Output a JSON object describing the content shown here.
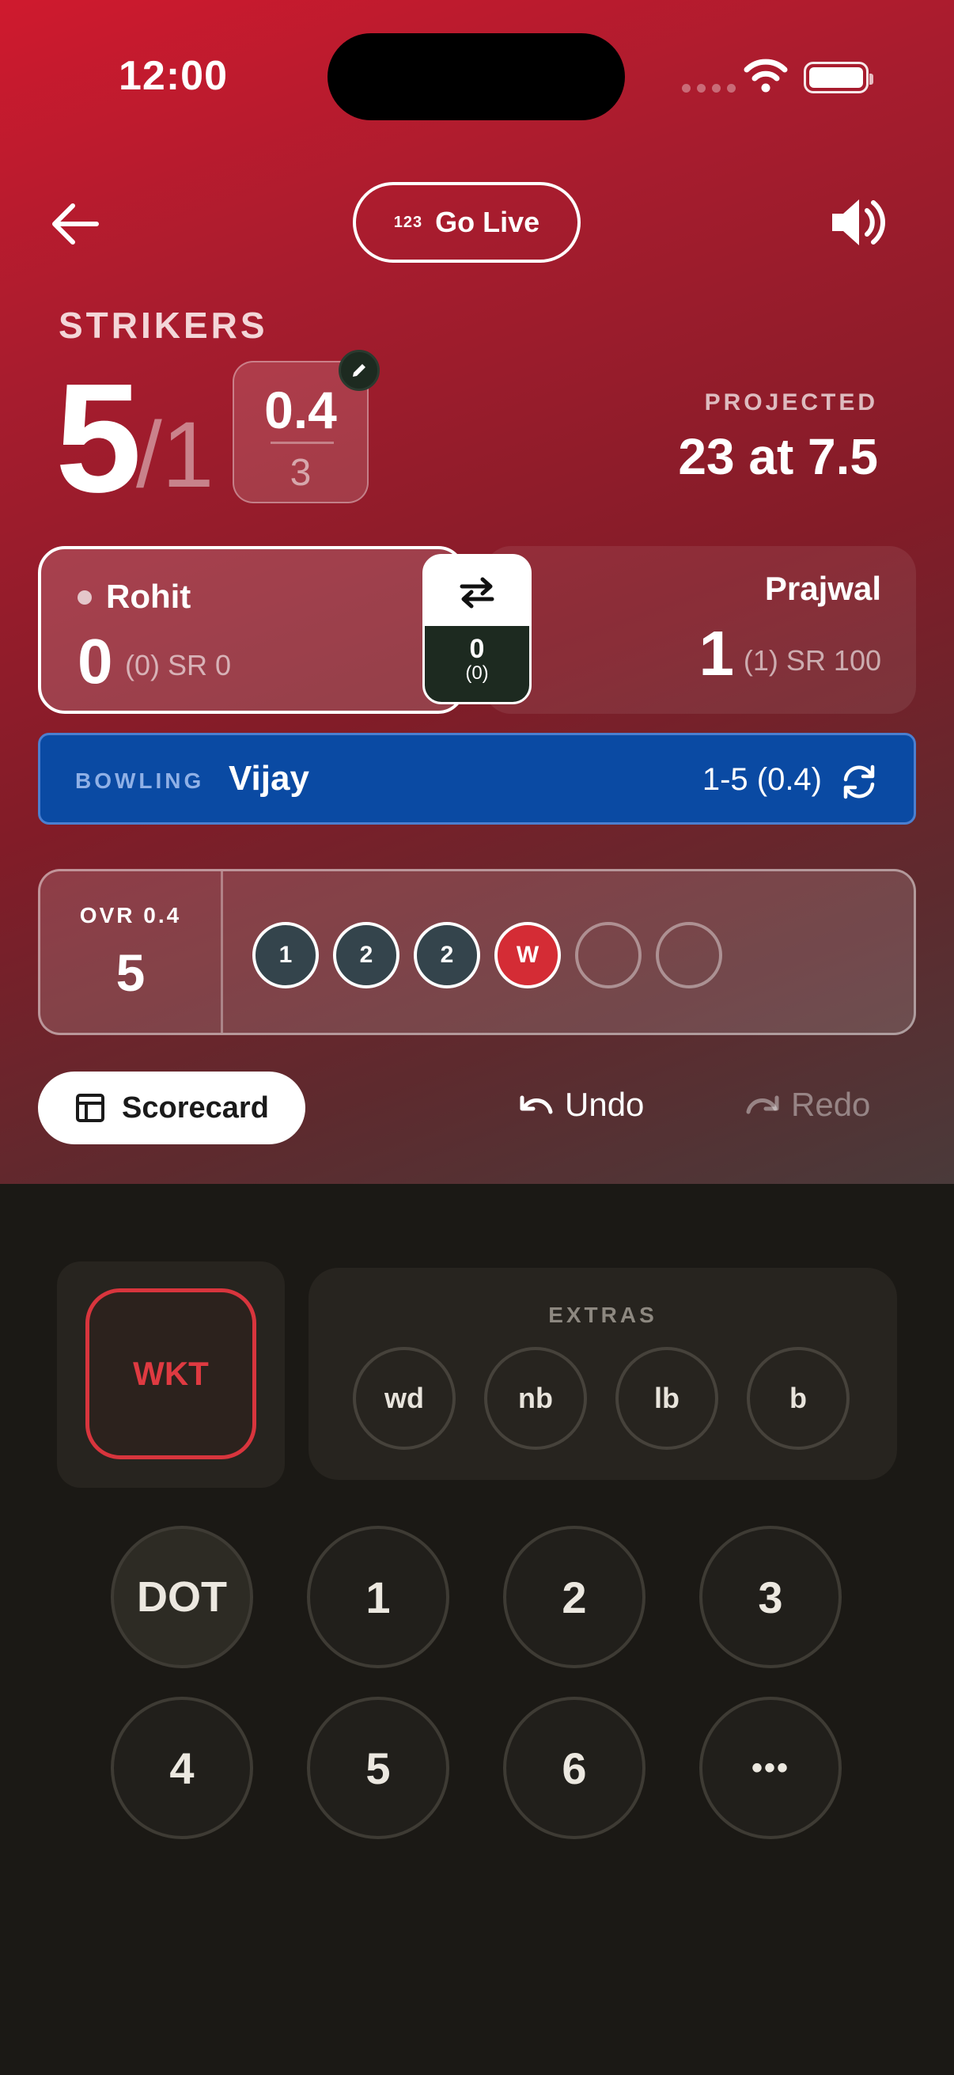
{
  "status_bar": {
    "time": "12:00"
  },
  "header": {
    "go_live_icon": "123",
    "go_live_label": "Go Live"
  },
  "score": {
    "team": "STRIKERS",
    "runs": "5",
    "wickets": "/1",
    "overs": "0.4",
    "max_overs": "3",
    "projected_label": "PROJECTED",
    "projected_value": "23 at 7.5"
  },
  "batters": {
    "striker": {
      "name": "Rohit",
      "runs": "0",
      "detail": "(0) SR 0"
    },
    "non_striker": {
      "name": "Prajwal",
      "runs": "1",
      "detail": "(1) SR 100"
    },
    "partnership_runs": "0",
    "partnership_balls": "(0)"
  },
  "bowling": {
    "label": "BOWLING",
    "name": "Vijay",
    "figures": "1-5 (0.4)"
  },
  "over": {
    "label": "OVR 0.4",
    "runs": "5",
    "balls": [
      "1",
      "2",
      "2",
      "W",
      "",
      ""
    ]
  },
  "actions": {
    "scorecard": "Scorecard",
    "undo": "Undo",
    "redo": "Redo"
  },
  "keypad": {
    "wicket": "WKT",
    "extras_label": "EXTRAS",
    "extras": [
      "wd",
      "nb",
      "lb",
      "b"
    ],
    "runs_row1": [
      "DOT",
      "1",
      "2",
      "3"
    ],
    "runs_row2": [
      "4",
      "5",
      "6",
      "•••"
    ]
  },
  "colors": {
    "accent_red": "#cf1a2e",
    "bowling_blue": "#0a4aa3",
    "wicket_red": "#d8353d",
    "keypad_bg": "#1b1915"
  }
}
